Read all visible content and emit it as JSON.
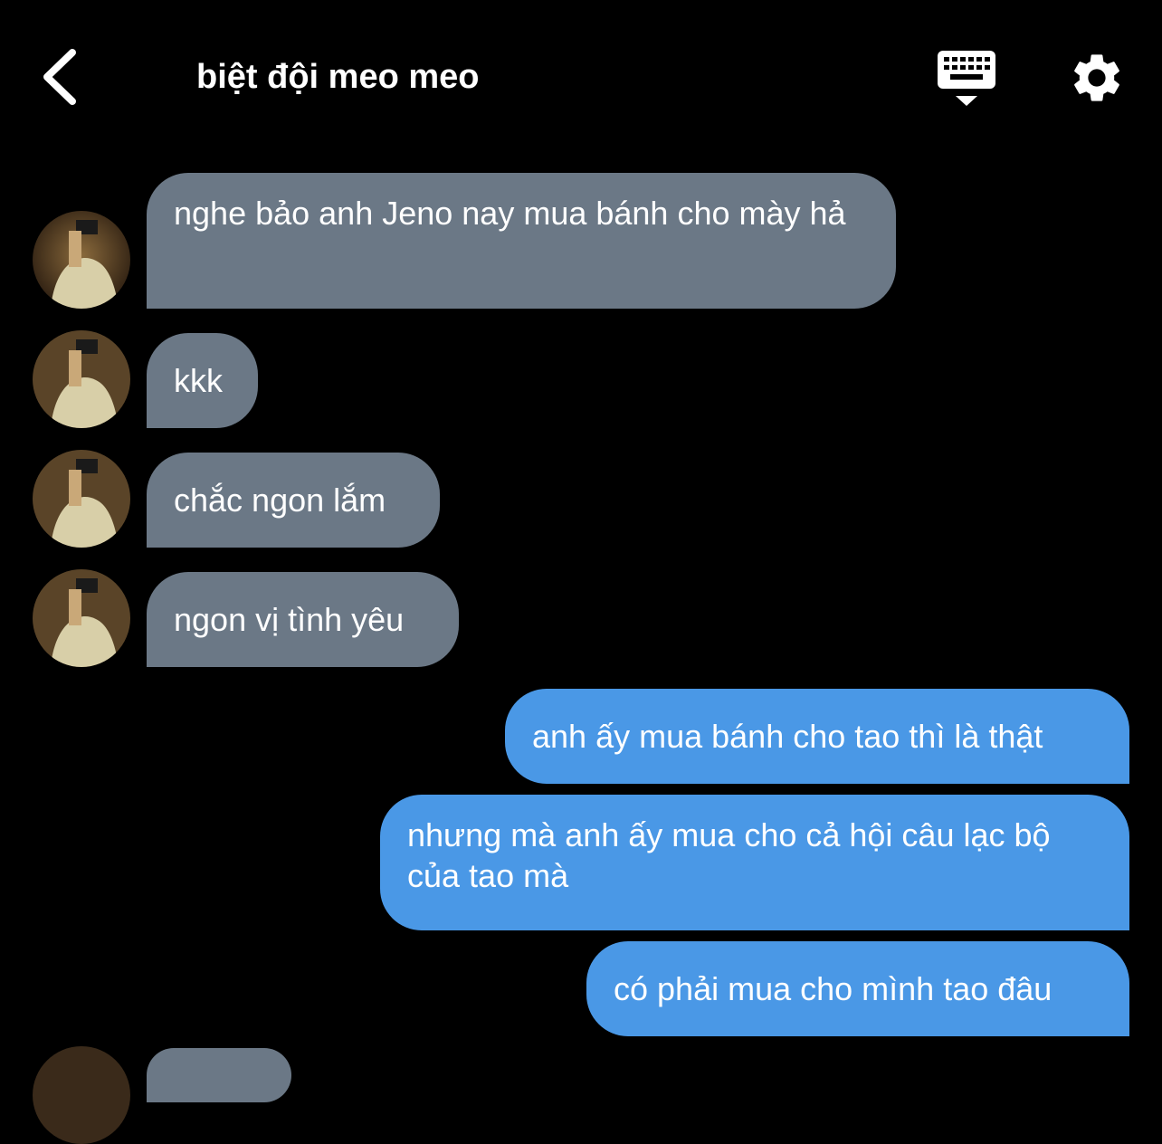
{
  "header": {
    "title": "biệt đội meo meo",
    "back_icon": "chevron-left-icon",
    "keyboard_icon": "keyboard-icon",
    "settings_icon": "gear-icon"
  },
  "colors": {
    "background": "#000000",
    "incoming_bubble": "#6b7886",
    "outgoing_bubble": "#4a98e6",
    "text": "#ffffff"
  },
  "messages": [
    {
      "direction": "incoming",
      "text": "nghe bảo anh Jeno nay mua bánh cho mày hả"
    },
    {
      "direction": "incoming",
      "text": "kkk"
    },
    {
      "direction": "incoming",
      "text": "chắc ngon lắm"
    },
    {
      "direction": "incoming",
      "text": "ngon vị tình yêu"
    },
    {
      "direction": "outgoing",
      "text": "anh ấy mua bánh cho tao thì là thật"
    },
    {
      "direction": "outgoing",
      "text": "nhưng mà anh ấy mua cho cả hội câu lạc bộ của tao mà"
    },
    {
      "direction": "outgoing",
      "text": "có phải mua cho mình tao đâu"
    }
  ]
}
